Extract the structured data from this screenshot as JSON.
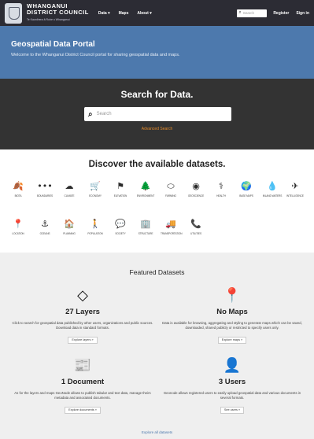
{
  "nav": {
    "logo_line1": "WHANGANUI",
    "logo_line2": "DISTRICT COUNCIL",
    "logo_tagline": "Te Kaunihera ā Rohe o Whanganui",
    "links": [
      "Data ▾",
      "Maps",
      "About ▾"
    ],
    "search_placeholder": "Search",
    "register": "Register",
    "signin": "Sign in"
  },
  "hero": {
    "title": "Geospatial Data Portal",
    "subtitle": "Welcome to the Whanganui District Council portal for sharing geospatial data and maps."
  },
  "search": {
    "title": "Search for Data.",
    "placeholder": "Search",
    "advanced": "Advanced Search"
  },
  "discover": {
    "title": "Discover the available datasets.",
    "categories": [
      {
        "icon": "leaf-icon",
        "glyph": "🍂",
        "label": "BIOTA"
      },
      {
        "icon": "dots-icon",
        "glyph": "•••",
        "label": "BOUNDARIES"
      },
      {
        "icon": "cloud-icon",
        "glyph": "☁",
        "label": "CLIMATE"
      },
      {
        "icon": "cart-icon",
        "glyph": "🛒",
        "label": "ECONOMY"
      },
      {
        "icon": "flag-icon",
        "glyph": "⚑",
        "label": "ELEVATION"
      },
      {
        "icon": "tree-icon",
        "glyph": "🌲",
        "label": "ENVIRONMENT"
      },
      {
        "icon": "leaf-outline-icon",
        "glyph": "⬭",
        "label": "FARMING"
      },
      {
        "icon": "target-icon",
        "glyph": "◉",
        "label": "GEOSCIENCE"
      },
      {
        "icon": "stethoscope-icon",
        "glyph": "⚕",
        "label": "HEALTH"
      },
      {
        "icon": "globe-icon",
        "glyph": "🌍",
        "label": "BASE MAPS"
      },
      {
        "icon": "drop-icon",
        "glyph": "💧",
        "label": "INLAND WATERS"
      },
      {
        "icon": "plane-icon",
        "glyph": "✈",
        "label": "INTELLIGENCE"
      },
      {
        "icon": "map-marker-icon",
        "glyph": "📍",
        "label": "LOCATION"
      },
      {
        "icon": "anchor-icon",
        "glyph": "⚓",
        "label": "OCEANS"
      },
      {
        "icon": "home-icon",
        "glyph": "🏠",
        "label": "PLANNING"
      },
      {
        "icon": "person-icon",
        "glyph": "🚶",
        "label": "POPULATION"
      },
      {
        "icon": "comments-icon",
        "glyph": "💬",
        "label": "SOCIETY"
      },
      {
        "icon": "building-icon",
        "glyph": "🏢",
        "label": "STRUCTURE"
      },
      {
        "icon": "truck-icon",
        "glyph": "🚚",
        "label": "TRANSPORTATION"
      },
      {
        "icon": "phone-icon",
        "glyph": "📞",
        "label": "UTILITIES"
      }
    ]
  },
  "featured": {
    "title": "Featured Datasets",
    "layers": {
      "icon": "diamond-icon",
      "glyph": "◇",
      "count": "27 Layers",
      "desc": "Click to search for geospatial data published by other users, organizations and public sources. Download data in standard formats.",
      "button": "Explore layers »"
    },
    "maps": {
      "icon": "map-marker-icon",
      "glyph": "📍",
      "count": "No Maps",
      "desc": "Data is available for browsing, aggregating and styling to generate maps which can be saved, downloaded, shared publicly or restricted to specify users only.",
      "button": "Explore maps »"
    },
    "documents": {
      "icon": "newspaper-icon",
      "glyph": "📰",
      "count": "1 Document",
      "desc": "As for the layers and maps GeoNode allows to publish tabular and text data, manage theirs metadata and associated documents.",
      "button": "Explore documents »"
    },
    "users": {
      "icon": "user-icon",
      "glyph": "👤",
      "count": "3 Users",
      "desc": "Geonode allows registered users to easily upload geospatial data and various documents in several formats.",
      "button": "See users »"
    },
    "explore_all": "Explore all datasets"
  }
}
